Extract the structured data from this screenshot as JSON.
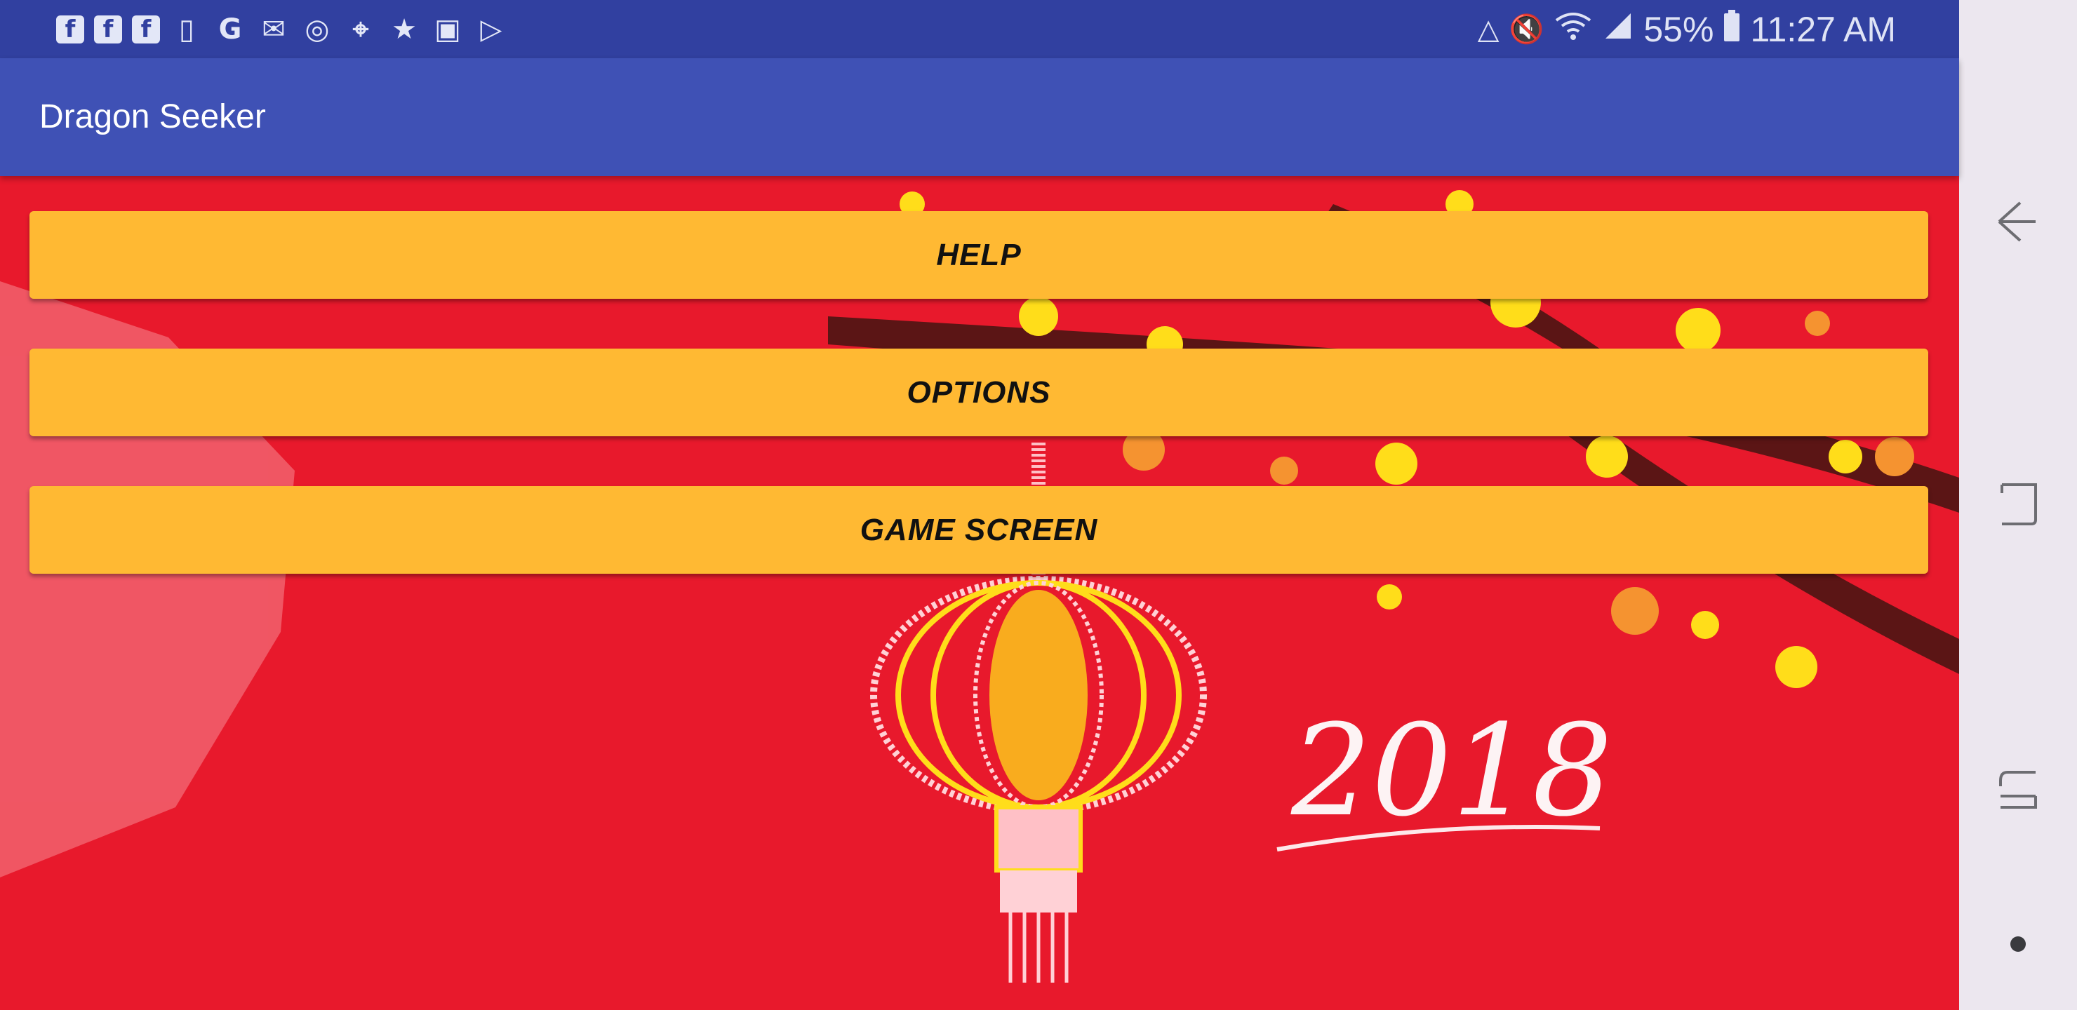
{
  "status_bar": {
    "notification_icons": [
      "facebook-icon",
      "facebook-icon",
      "facebook-icon",
      "app-icon",
      "google-icon",
      "gmail-icon",
      "chrome-icon",
      "maps-icon",
      "star-icon",
      "gallery-icon",
      "play-store-icon"
    ],
    "battery_percent": "55%",
    "time": "11:27 AM"
  },
  "app_bar": {
    "title": "Dragon Seeker"
  },
  "menu": {
    "help_label": "HELP",
    "options_label": "OPTIONS",
    "game_screen_label": "GAME SCREEN"
  },
  "background": {
    "year_text": "2018"
  },
  "colors": {
    "status_bar": "#3140a0",
    "app_bar": "#3f51b5",
    "content_bg": "#e8192c",
    "button_bg": "#ffb933",
    "nav_bar": "#ece7ef"
  },
  "nav_bar": {
    "icons": [
      "back-icon",
      "recents-icon",
      "home-icon",
      "dot-icon"
    ]
  }
}
